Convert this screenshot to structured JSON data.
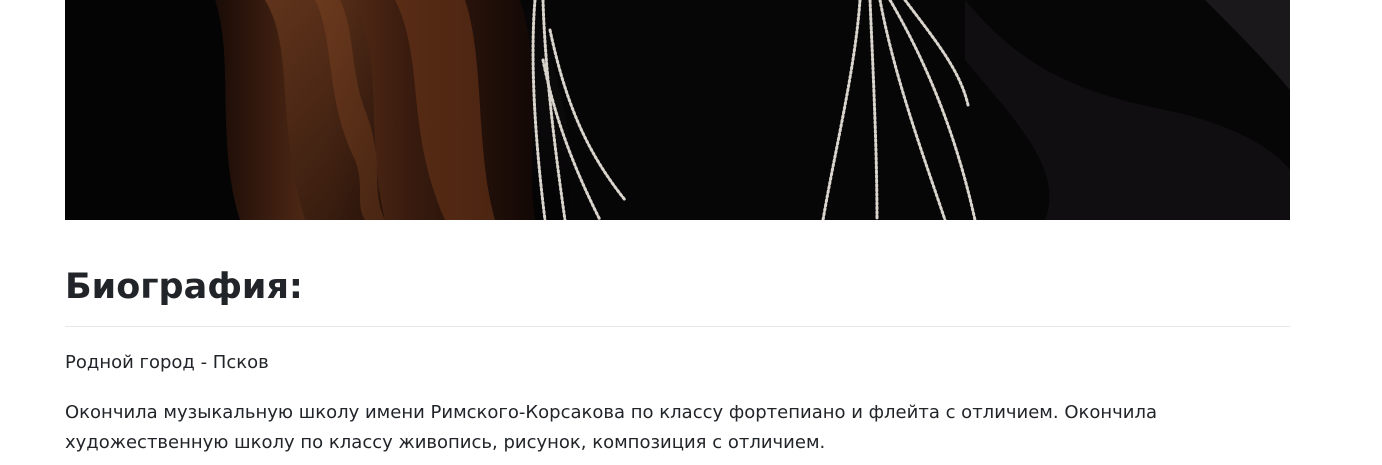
{
  "photo": {
    "alt": "",
    "colors": {
      "background": "#060405",
      "hair": "#4a2515",
      "earring": "#d9d4cc"
    }
  },
  "biography": {
    "heading": "Биография:",
    "hometown": "Родной город - Псков",
    "education": "Окончила музыкальную школу имени Римского-Корсакова по классу фортепиано и флейта с отличием. Окончила художественную школу по классу живопись, рисунок, композиция с отличием."
  }
}
